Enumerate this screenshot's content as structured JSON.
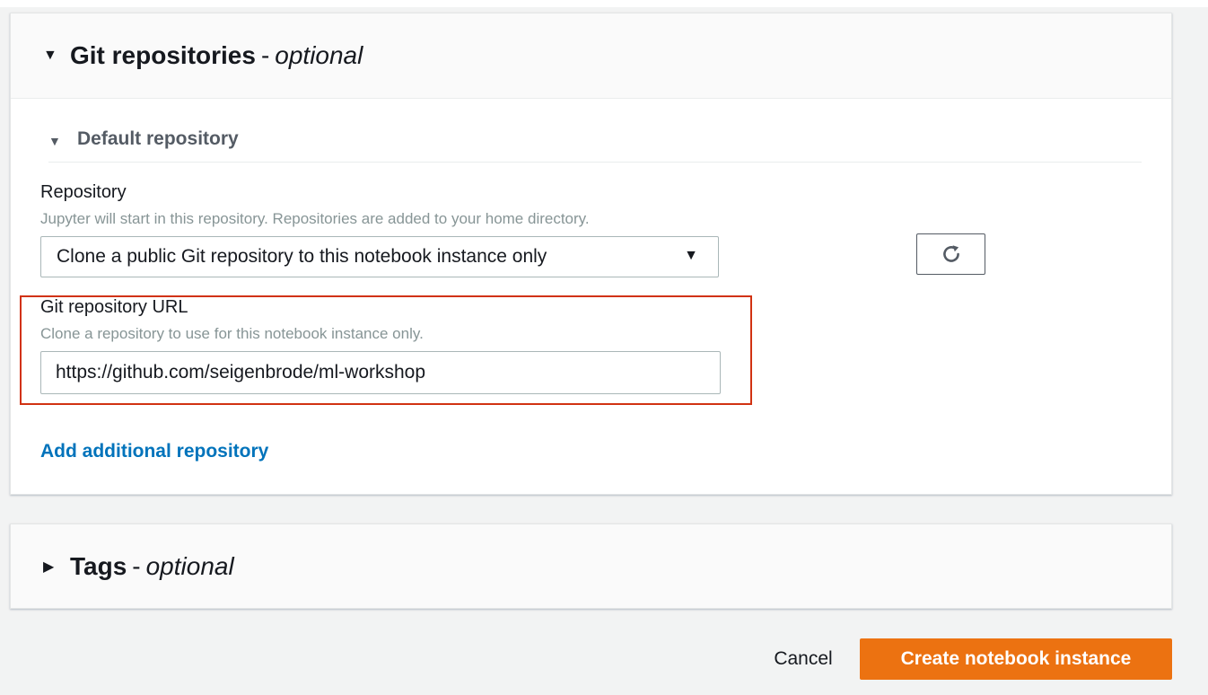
{
  "git_section": {
    "title": "Git repositories",
    "separator": "-",
    "optional": "optional",
    "expanded_icon": "caret-down-icon",
    "default_repo": {
      "title": "Default repository",
      "repository_label": "Repository",
      "repository_hint": "Jupyter will start in this repository. Repositories are added to your home directory.",
      "repository_selected": "Clone a public Git repository to this notebook instance only",
      "refresh_icon": "refresh-icon",
      "url_label": "Git repository URL",
      "url_hint": "Clone a repository to use for this notebook instance only.",
      "url_value": "https://github.com/seigenbrode/ml-workshop"
    },
    "add_link": "Add additional repository"
  },
  "tags_section": {
    "title": "Tags",
    "separator": "-",
    "optional": "optional",
    "collapsed_icon": "caret-right-icon"
  },
  "footer": {
    "cancel_label": "Cancel",
    "create_label": "Create notebook instance"
  },
  "colors": {
    "primary_button": "#ec7211",
    "link": "#0073bb",
    "highlight_border": "#d13212",
    "hint_text": "#879596"
  }
}
